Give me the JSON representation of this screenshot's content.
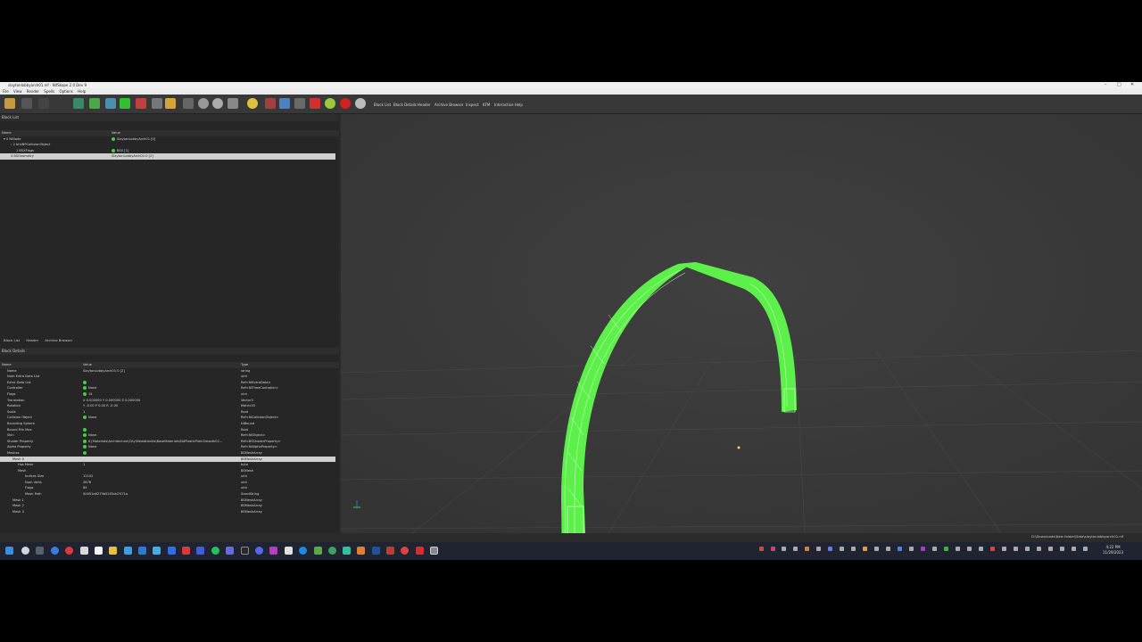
{
  "window": {
    "title": "slaytonlobbyarch01.nif - NifSkope 2.0 Dev 9"
  },
  "menu": [
    "File",
    "View",
    "Render",
    "Spells",
    "Options",
    "Help"
  ],
  "tool_tabs": [
    "Block List",
    "Block Details",
    "Header",
    "Archive Browser",
    "Inspect",
    "KFM",
    "Interactive Help"
  ],
  "block_list": {
    "title": "Block List",
    "headers": [
      "Name",
      "Value"
    ],
    "rows": [
      {
        "name": "0 NiNode",
        "value": "SlaytonLobbyArch01 [0]"
      },
      {
        "name": "2 bhkNPCollisionObject",
        "value": ""
      },
      {
        "name": "1 BSXFlags",
        "value": "BSX [1]"
      },
      {
        "name": "4 BSGeometry",
        "value": "SlaytonLobbyArch01:0 [2]"
      }
    ]
  },
  "tabs": [
    "Block List",
    "Header",
    "Archive Browser"
  ],
  "block_details": {
    "title": "Block Details",
    "headers": [
      "Name",
      "Value",
      "Type"
    ],
    "rows": [
      {
        "name": "Name",
        "value": "SlaytonLobbyArch01:0 [2]",
        "type": "string"
      },
      {
        "name": "Num Extra Data List",
        "value": "",
        "type": "uint"
      },
      {
        "name": "Extra Data List",
        "value": "",
        "type": "Ref<NiExtraData>"
      },
      {
        "name": "Controller",
        "value": "None",
        "type": "Ref<NiTimeController>"
      },
      {
        "name": "Flags",
        "value": "14",
        "type": "uint"
      },
      {
        "name": "Translation",
        "value": "X 0.000000 Y 0.000000 Z 0.000000",
        "type": "Vector3"
      },
      {
        "name": "Rotation",
        "value": "Y -0.00 P 0.00 R -0.00",
        "type": "Matrix33"
      },
      {
        "name": "Scale",
        "value": "1",
        "type": "float"
      },
      {
        "name": "Collision Object",
        "value": "None",
        "type": "Ref<NiCollisionObject>"
      },
      {
        "name": "Bounding Sphere",
        "value": "",
        "type": "NiBound"
      },
      {
        "name": "Bound Min Max",
        "value": "",
        "type": "float"
      },
      {
        "name": "Skin",
        "value": "None",
        "type": "Ref<NiObject>"
      },
      {
        "name": "Shader Property",
        "value": "6 [Materials\\Architecture\\City\\NewAtlantis\\BaseMaterials\\NAPlasticPlainSmooth02...",
        "type": "Ref<BSShaderProperty>"
      },
      {
        "name": "Alpha Property",
        "value": "None",
        "type": "Ref<NiAlphaProperty>"
      },
      {
        "name": "Meshes",
        "value": "",
        "type": "BSMeshArray"
      },
      {
        "name": "Mesh 0",
        "value": "",
        "type": "BSMeshArray"
      },
      {
        "name": "Has Mesh",
        "value": "1",
        "type": "byte"
      },
      {
        "name": "Mesh",
        "value": "",
        "type": "BSMesh"
      },
      {
        "name": "Indices Size",
        "value": "11102",
        "type": "uint"
      },
      {
        "name": "Num Verts",
        "value": "2878",
        "type": "uint"
      },
      {
        "name": "Flags",
        "value": "64",
        "type": "uint"
      },
      {
        "name": "Mesh Path",
        "value": "00051a6279b5255dd7471a",
        "type": "SizedString"
      },
      {
        "name": "Mesh 1",
        "value": "",
        "type": "BSMeshArray"
      },
      {
        "name": "Mesh 2",
        "value": "",
        "type": "BSMeshArray"
      },
      {
        "name": "Mesh 3",
        "value": "",
        "type": "BSMeshArray"
      }
    ]
  },
  "status": {
    "path": "D:\\Downloads\\New folder\\Data\\slaytonlobbyarch01.nif"
  },
  "clock": {
    "time": "4:22 PM",
    "date": "11/29/2023"
  },
  "colors": {
    "accent": "#5ef04a"
  }
}
